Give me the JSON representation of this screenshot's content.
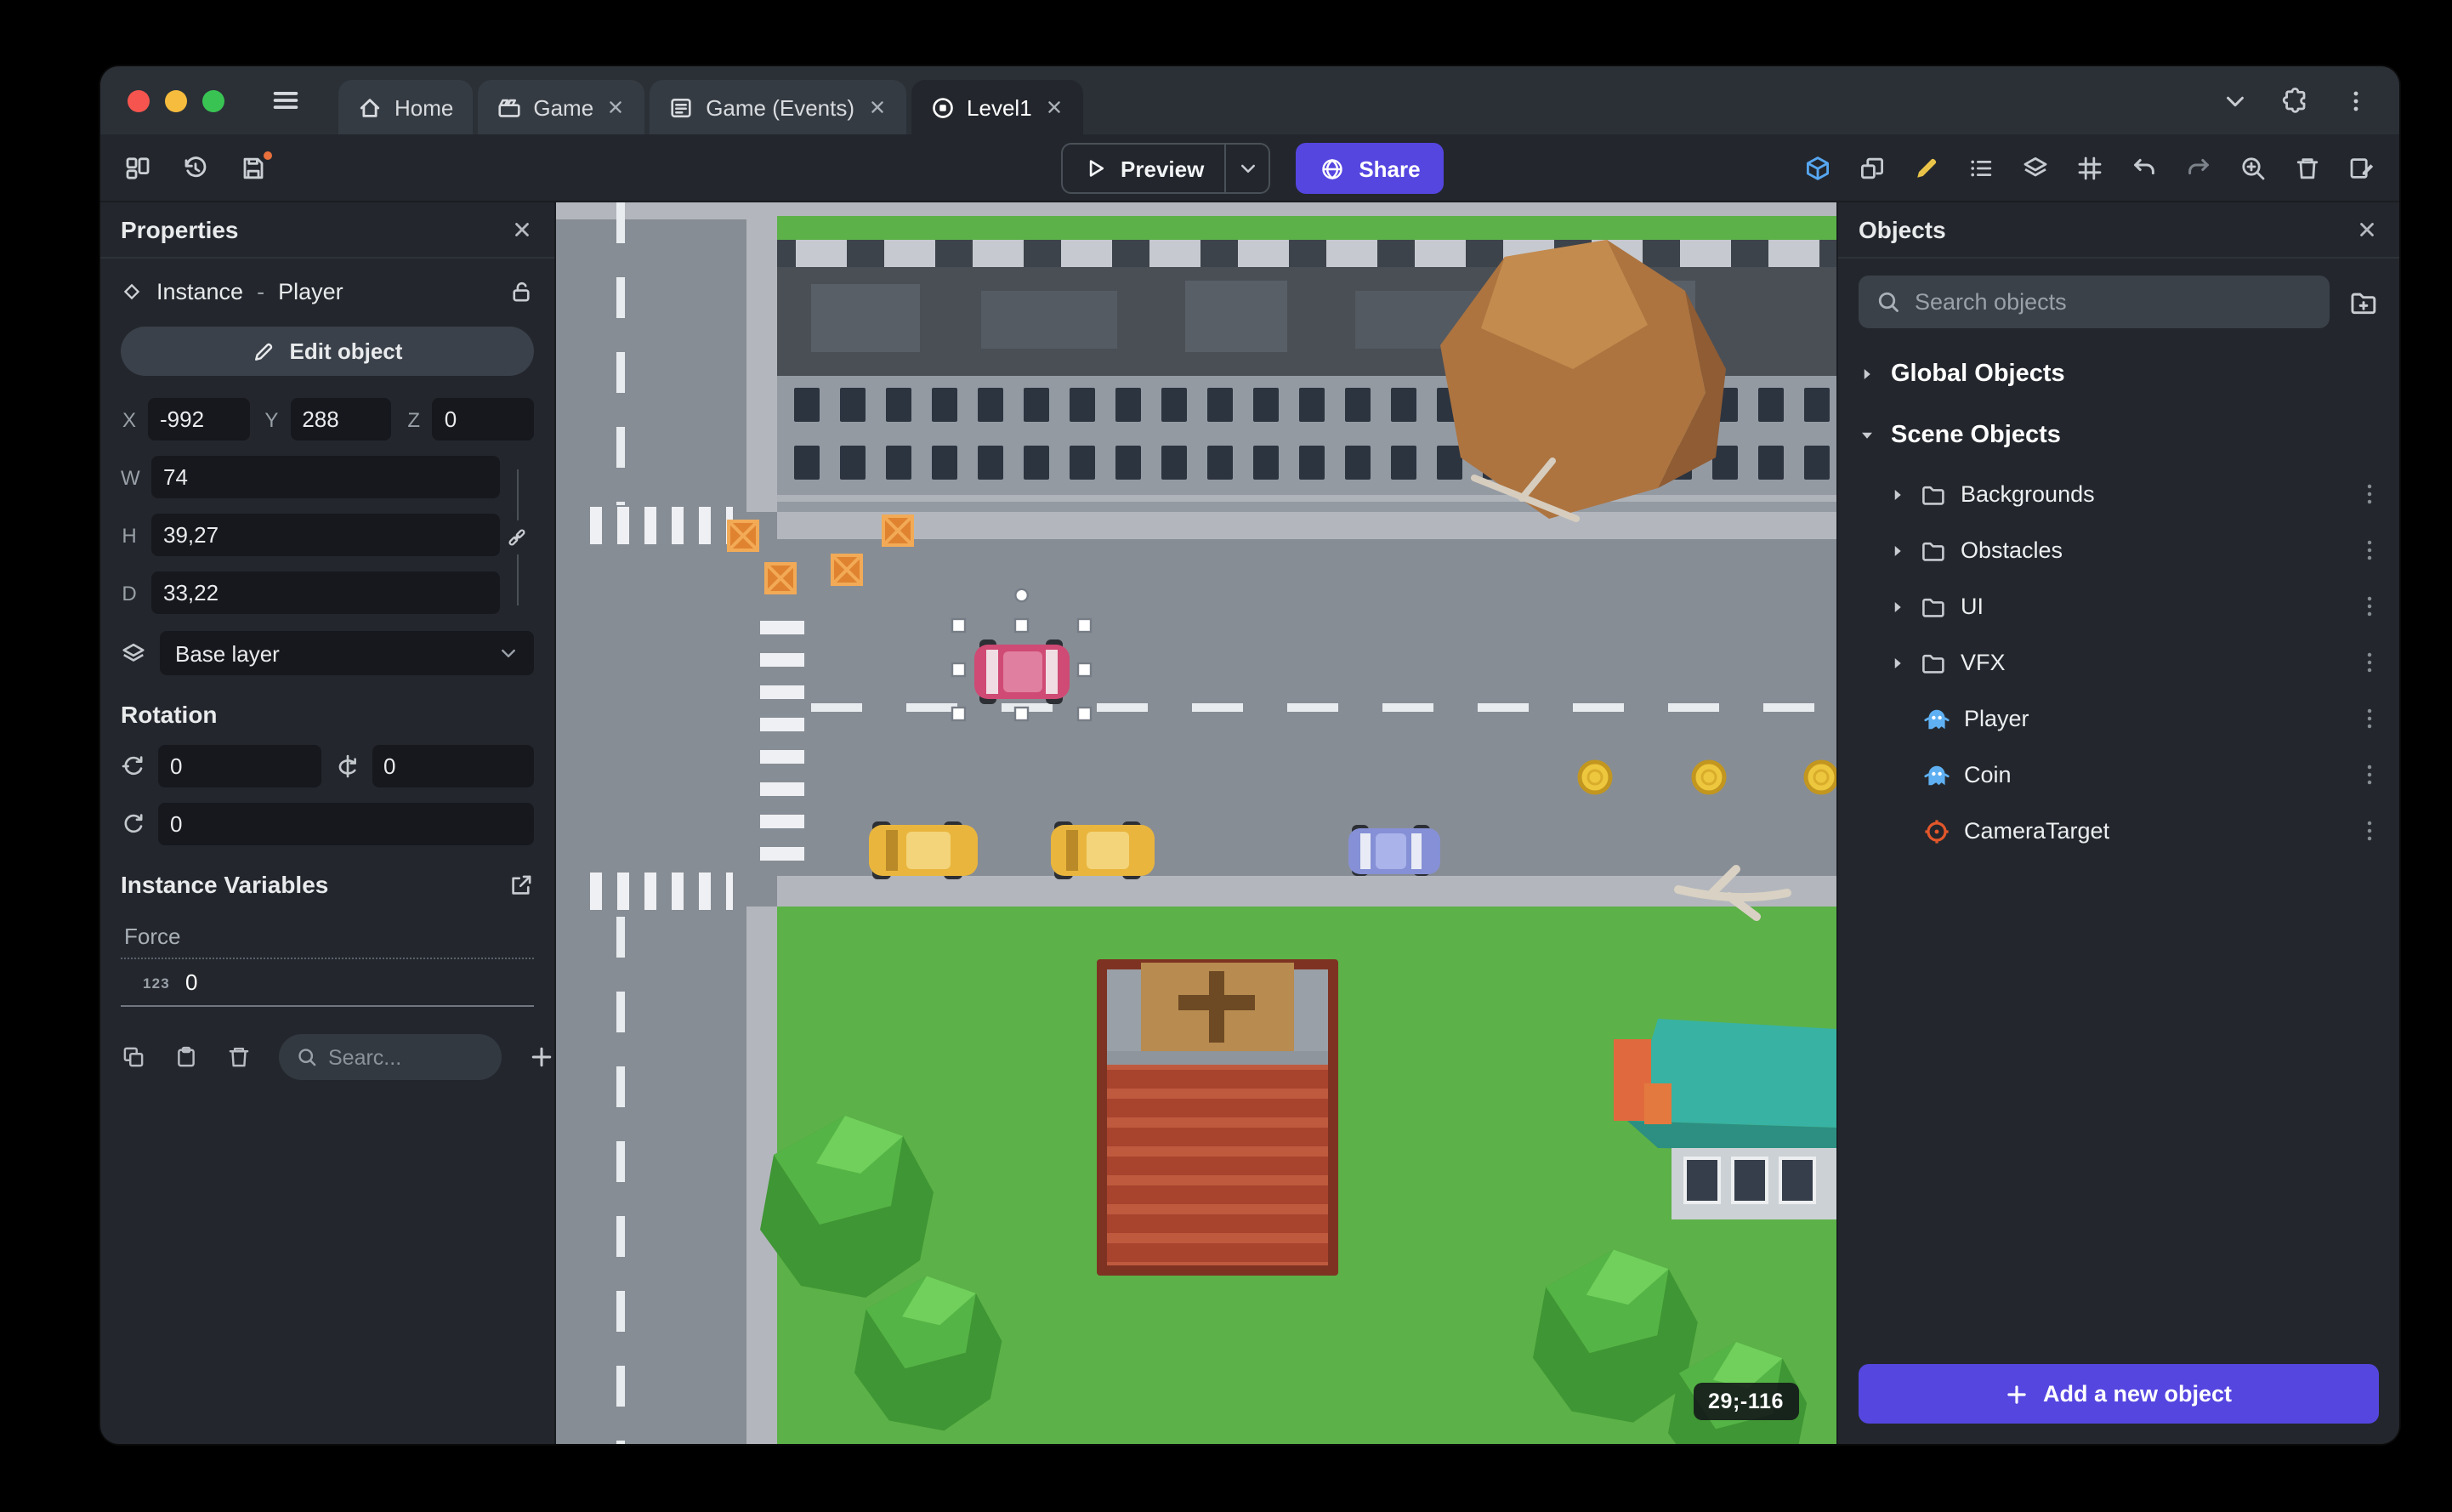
{
  "colors": {
    "accent_purple": "#5546e0",
    "active_tool_blue": "#57a7f2",
    "active_tool_yellow": "#eac449",
    "unsaved_dot_orange": "#e8703c",
    "selected_object_color": "#cf4a74",
    "traffic_red": "#f5554e",
    "traffic_yellow": "#f6bc3e",
    "traffic_green": "#39c353"
  },
  "titlebar": {
    "tabs": [
      {
        "label": "Home",
        "icon": "home-icon",
        "closable": false,
        "active": false
      },
      {
        "label": "Game",
        "icon": "clapperboard-icon",
        "closable": true,
        "active": false
      },
      {
        "label": "Game (Events)",
        "icon": "events-sheet-icon",
        "closable": true,
        "active": false
      },
      {
        "label": "Level1",
        "icon": "scene-icon",
        "closable": true,
        "active": true
      }
    ]
  },
  "toolbar": {
    "preview_label": "Preview",
    "share_label": "Share"
  },
  "properties_panel": {
    "title": "Properties",
    "instance_kind": "Instance",
    "instance_separator": "-",
    "instance_name": "Player",
    "edit_object_label": "Edit object",
    "position": {
      "x_label": "X",
      "x_value": "-992",
      "y_label": "Y",
      "y_value": "288",
      "z_label": "Z",
      "z_value": "0"
    },
    "size": {
      "w_label": "W",
      "w_value": "74",
      "h_label": "H",
      "h_value": "39,27",
      "d_label": "D",
      "d_value": "33,22"
    },
    "layer_value": "Base layer",
    "rotation_title": "Rotation",
    "rotation": {
      "x_value": "0",
      "y_value": "0",
      "z_value": "0"
    },
    "instance_variables_title": "Instance Variables",
    "variables": [
      {
        "name": "Force",
        "type_label": "123",
        "value": "0"
      }
    ],
    "variables_search_placeholder": "Searc..."
  },
  "canvas": {
    "cursor_coordinates": "29;-116"
  },
  "objects_panel": {
    "title": "Objects",
    "search_placeholder": "Search objects",
    "global_group_label": "Global Objects",
    "scene_group_label": "Scene Objects",
    "folders": [
      {
        "label": "Backgrounds"
      },
      {
        "label": "Obstacles"
      },
      {
        "label": "UI"
      },
      {
        "label": "VFX"
      }
    ],
    "objects": [
      {
        "label": "Player",
        "icon": "sprite-icon"
      },
      {
        "label": "Coin",
        "icon": "sprite-icon"
      },
      {
        "label": "CameraTarget",
        "icon": "camera-target-icon"
      }
    ],
    "add_object_label": "Add a new object"
  }
}
